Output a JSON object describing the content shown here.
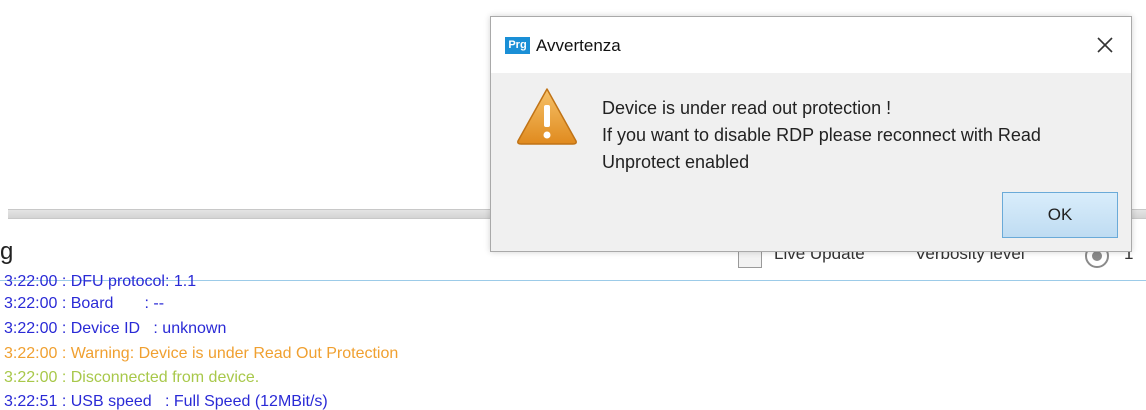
{
  "log_panel": {
    "title": "g",
    "live_update_label": "Live Update",
    "verbosity_label": "Verbosity level",
    "verbosity_value": "1",
    "lines": [
      {
        "text": "3:22:00 : DFU protocol: 1.1",
        "color": "#2a2ad6"
      },
      {
        "text": "3:22:00 : Board       : --",
        "color": "#2a2ad6"
      },
      {
        "text": "3:22:00 : Device ID   : unknown",
        "color": "#2a2ad6"
      },
      {
        "text": "3:22:00 : Warning: Device is under Read Out Protection",
        "color": "#f0a030"
      },
      {
        "text": "3:22:00 : Disconnected from device.",
        "color": "#a8c84a"
      },
      {
        "text": "3:22:51 : USB speed   : Full Speed (12MBit/s)",
        "color": "#2a2ad6"
      }
    ]
  },
  "dialog": {
    "logo_text": "Prg",
    "title": "Avvertenza",
    "message_lines": [
      "Device is under read out protection !",
      "If you want to disable RDP please reconnect with Read",
      "Unprotect enabled"
    ],
    "ok_label": "OK",
    "icons": {
      "close": "close-icon",
      "warning": "warning-icon"
    }
  },
  "colors": {
    "accent": "#1a8fd6",
    "warning": "#f0a030",
    "log_blue": "#2a2ad6",
    "log_green": "#a8c84a"
  }
}
